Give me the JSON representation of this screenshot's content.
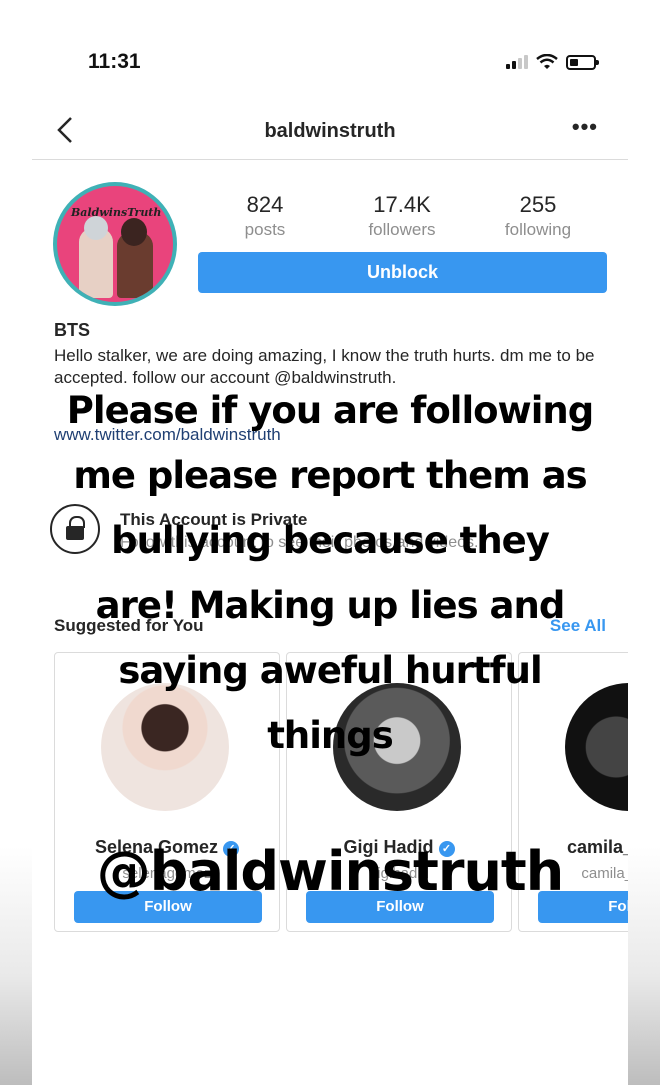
{
  "status_bar": {
    "time": "11:31"
  },
  "nav": {
    "back_icon": "chevron-left-icon",
    "title": "baldwinstruth",
    "more_label": "•••"
  },
  "profile": {
    "avatar_text": "BaldwinsTruth",
    "stats": [
      {
        "value": "824",
        "label": "posts"
      },
      {
        "value": "17.4K",
        "label": "followers"
      },
      {
        "value": "255",
        "label": "following"
      }
    ],
    "unblock_label": "Unblock",
    "name": "BTS",
    "bio": "Hello stalker, we are doing amazing, I know the truth hurts. dm me to be accepted. follow our account @baldwinstruth.",
    "link": "www.twitter.com/baldwinstruth"
  },
  "private": {
    "title": "This Account is Private",
    "subtitle": "Follow this account to see their photos and videos."
  },
  "suggested": {
    "title": "Suggested for You",
    "see_all": "See All",
    "cards": [
      {
        "name": "Selena Gomez",
        "handle": "selenagomez",
        "follow": "Follow"
      },
      {
        "name": "Gigi Hadid",
        "handle": "gigihadid",
        "follow": "Follow"
      },
      {
        "name": "camila_cabello",
        "handle": "camila_cabello",
        "follow": "Follow"
      }
    ]
  },
  "overlay": {
    "lines": [
      "Please if you are following",
      "me please report them as",
      "bullying because they",
      "are! Making up lies and",
      "saying aweful hurtful",
      "things"
    ],
    "handle": "@baldwinstruth"
  },
  "colors": {
    "accent": "#3897f0",
    "avatar_ring": "#3fb1b6",
    "avatar_bg": "#e9447c"
  }
}
